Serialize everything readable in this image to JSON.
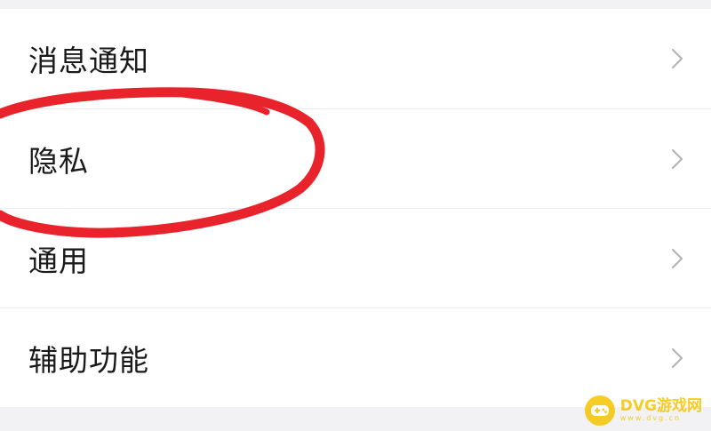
{
  "settings": {
    "items": [
      {
        "label": "消息通知",
        "icon": "chevron-right-icon"
      },
      {
        "label": "隐私",
        "icon": "chevron-right-icon"
      },
      {
        "label": "通用",
        "icon": "chevron-right-icon"
      },
      {
        "label": "辅助功能",
        "icon": "chevron-right-icon"
      }
    ]
  },
  "annotation": {
    "shape": "hand-drawn circle around 隐私",
    "color": "#e8232b"
  },
  "watermark": {
    "title": "DVG游戏网",
    "subtitle": "www.dvg.cn",
    "color": "#f5c400"
  }
}
